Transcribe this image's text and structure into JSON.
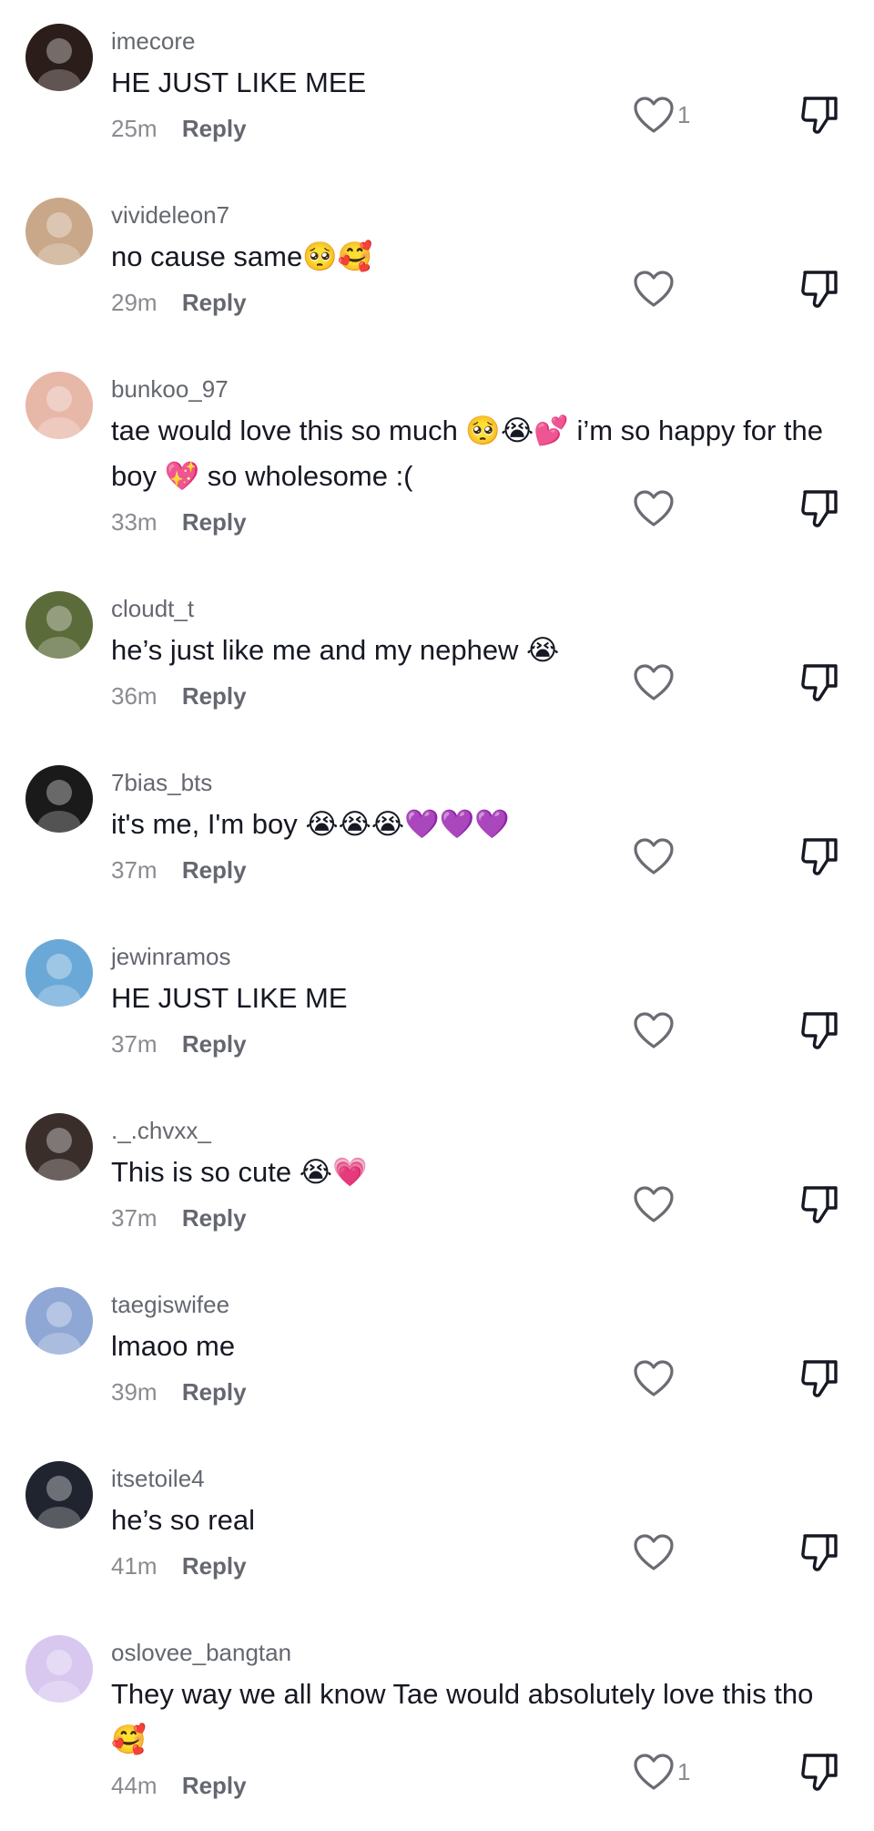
{
  "reply_label": "Reply",
  "comments": [
    {
      "username": "imecore",
      "text": "HE JUST LIKE MEE",
      "time": "25m",
      "likes": "1",
      "avatar_color": "#2b1d1a"
    },
    {
      "username": "vivideleon7",
      "text": "no cause same🥺🥰",
      "time": "29m",
      "likes": "",
      "avatar_color": "#c9a789"
    },
    {
      "username": "bunkoo_97",
      "text": "tae would love this so much 🥺😭💕 i’m so happy for the boy 💖 so wholesome :(",
      "time": "33m",
      "likes": "",
      "avatar_color": "#e7b7a8"
    },
    {
      "username": "cloudt_t",
      "text": "he’s just like me and my nephew 😭",
      "time": "36m",
      "likes": "",
      "avatar_color": "#5b6b3a"
    },
    {
      "username": "7bias_bts",
      "text": "it's me, I'm boy 😭😭😭💜💜💜",
      "time": "37m",
      "likes": "",
      "avatar_color": "#1a1a1a"
    },
    {
      "username": "jewinramos",
      "text": "HE JUST LIKE ME",
      "time": "37m",
      "likes": "",
      "avatar_color": "#6aa8d8"
    },
    {
      "username": "._.chvxx_",
      "text": "This is so cute 😭💗",
      "time": "37m",
      "likes": "",
      "avatar_color": "#3a2e2b"
    },
    {
      "username": "taegiswifee",
      "text": "lmaoo me",
      "time": "39m",
      "likes": "",
      "avatar_color": "#8fa7d4"
    },
    {
      "username": "itsetoile4",
      "text": "he’s so real",
      "time": "41m",
      "likes": "",
      "avatar_color": "#20242e"
    },
    {
      "username": "oslovee_bangtan",
      "text": "They way we all know Tae would absolutely love this tho 🥰",
      "time": "44m",
      "likes": "1",
      "avatar_color": "#d8c8f0"
    }
  ]
}
